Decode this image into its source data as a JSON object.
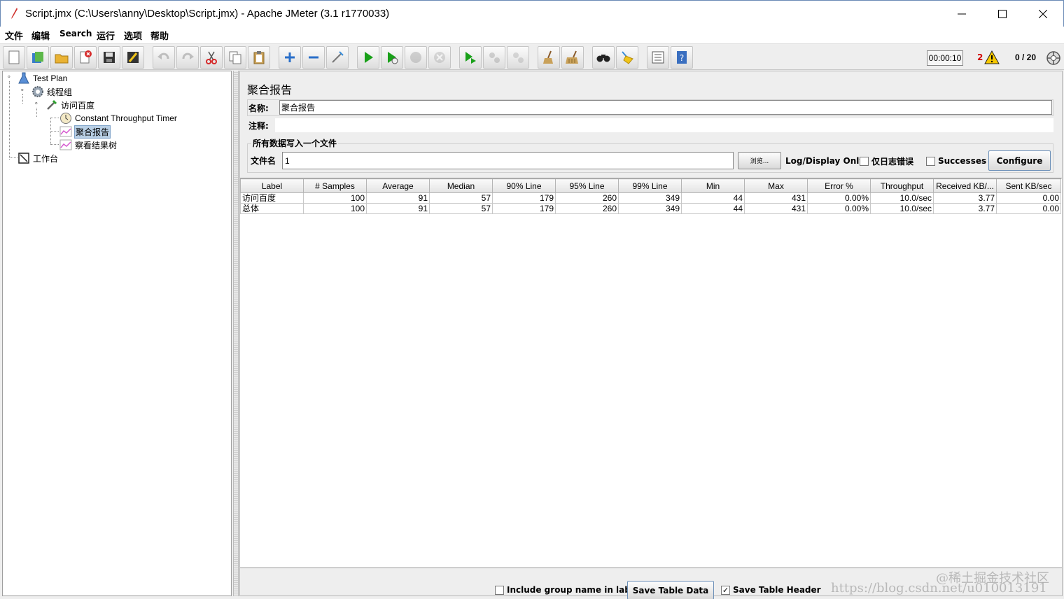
{
  "window": {
    "title": "Script.jmx (C:\\Users\\anny\\Desktop\\Script.jmx) - Apache JMeter (3.1 r1770033)"
  },
  "menu": [
    "文件",
    "编辑",
    "Search",
    "运行",
    "选项",
    "帮助"
  ],
  "status": {
    "timer": "00:00:10",
    "error_count": "2",
    "threads": "0 / 20"
  },
  "tree": {
    "test_plan": "Test Plan",
    "thread_group": "线程组",
    "sampler": "访问百度",
    "timer": "Constant Throughput Timer",
    "aggregate_report": "聚合报告",
    "results_tree": "察看结果树",
    "workbench": "工作台"
  },
  "panel": {
    "title": "聚合报告",
    "name_label": "名称:",
    "name_value": "聚合报告",
    "comment_label": "注释:",
    "file_group_legend": "所有数据写入一个文件",
    "file_label": "文件名",
    "file_value": "1",
    "browse": "浏览...",
    "log_display": "Log/Display Only:",
    "errors_only": "仅日志错误",
    "successes": "Successes",
    "configure": "Configure"
  },
  "table": {
    "headers": [
      "Label",
      "# Samples",
      "Average",
      "Median",
      "90% Line",
      "95% Line",
      "99% Line",
      "Min",
      "Max",
      "Error %",
      "Throughput",
      "Received KB/...",
      "Sent KB/sec"
    ],
    "rows": [
      [
        "访问百度",
        "100",
        "91",
        "57",
        "179",
        "260",
        "349",
        "44",
        "431",
        "0.00%",
        "10.0/sec",
        "3.77",
        "0.00"
      ],
      [
        "总体",
        "100",
        "91",
        "57",
        "179",
        "260",
        "349",
        "44",
        "431",
        "0.00%",
        "10.0/sec",
        "3.77",
        "0.00"
      ]
    ]
  },
  "bottom": {
    "include_group": "Include group name in label?",
    "save_table_data": "Save Table Data",
    "save_table_header": "Save Table Header"
  },
  "watermark": {
    "line1": "@稀土掘金技术社区",
    "line2": "https://blog.csdn.net/u010013191"
  },
  "colors": {
    "selection": "#b8cfe5",
    "error_red": "#d00000",
    "run_green": "#19a019"
  }
}
